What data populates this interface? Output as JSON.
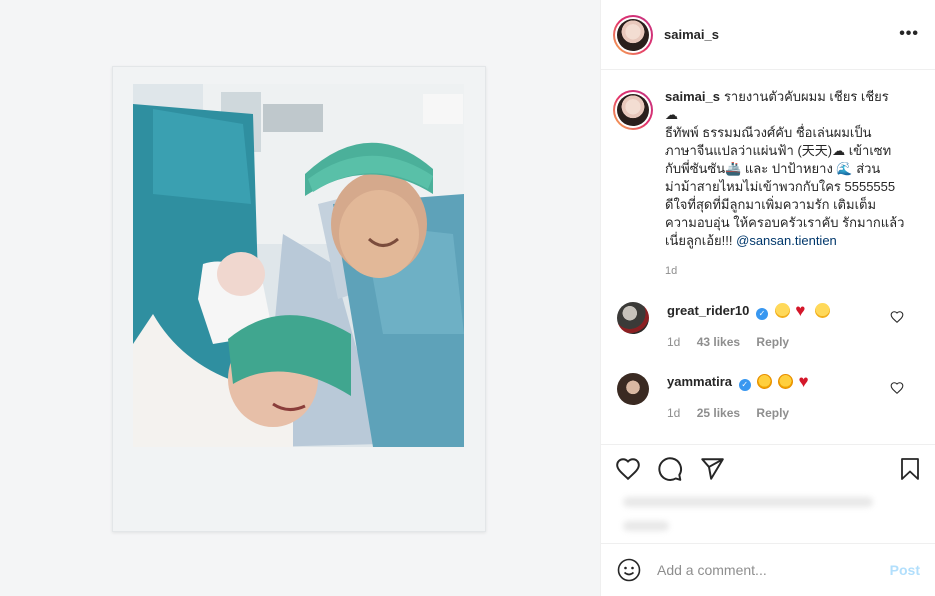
{
  "post": {
    "username": "saimai_s"
  },
  "caption": {
    "username": "saimai_s",
    "lines": [
      "รายงานตัวคับผมม เชียร เชียร",
      "☁",
      "ธีทัพพ์ ธรรมมณีวงศ์คับ ชื่อเล่นผมเป็น",
      "ภาษาจีนแปลว่าแผ่นฟ้า (天天)☁ เข้าเซท",
      "กับพี่ซันซัน🚢 และ ปาป้าหยาง 🌊 ส่วน",
      "ม่าม้าสายไหมไม่เข้าพวกกับใคร 5555555",
      "ดีใจที่สุดที่มีลูกมาเพิ่มความรัก เติมเต็ม",
      "ความอบอุ่น ให้ครอบครัวเราคับ รักมากแล้ว",
      "เนี่ยลูกเอ้ย!!!"
    ],
    "mention": "@sansan.tientien",
    "time": "1d"
  },
  "comments": [
    {
      "username": "great_rider10",
      "time": "1d",
      "likes": "43 likes",
      "reply": "Reply"
    },
    {
      "username": "yammatira",
      "time": "1d",
      "likes": "25 likes",
      "reply": "Reply"
    }
  ],
  "add_comment": {
    "placeholder": "Add a comment...",
    "post_label": "Post"
  },
  "colors": {
    "accent_link": "#00376b",
    "verified": "#3897f0",
    "post_disabled": "#b2dffc"
  }
}
